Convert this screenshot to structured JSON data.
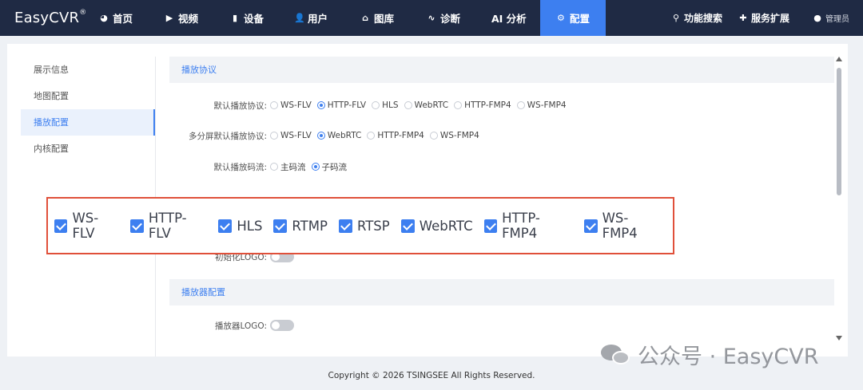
{
  "app": {
    "logo": "EasyCVR",
    "logo_mark": "®"
  },
  "nav": {
    "items": [
      {
        "label": "首页",
        "icon": "dashboard-icon",
        "glyph": "◕"
      },
      {
        "label": "视频",
        "icon": "play-icon",
        "glyph": "▶"
      },
      {
        "label": "设备",
        "icon": "device-icon",
        "glyph": "▮"
      },
      {
        "label": "用户",
        "icon": "user-icon",
        "glyph": "👤"
      },
      {
        "label": "图库",
        "icon": "gallery-icon",
        "glyph": "⌂"
      },
      {
        "label": "诊断",
        "icon": "pulse-icon",
        "glyph": "∿"
      },
      {
        "label": "AI 分析",
        "icon": "ai-icon",
        "glyph": ""
      },
      {
        "label": "配置",
        "icon": "gear-icon",
        "glyph": "⚙"
      }
    ],
    "active": "配置",
    "search_label": "功能搜索",
    "extension_label": "服务扩展",
    "user_label": "管理员",
    "accent_color": "#3d7ff0",
    "bg_color": "#1f2a44"
  },
  "sidebar": {
    "items": [
      "展示信息",
      "地图配置",
      "播放配置",
      "内核配置"
    ],
    "active": "播放配置"
  },
  "sections": {
    "play_protocol": "播放协议",
    "player_config": "播放器配置"
  },
  "rows": {
    "default_protocol": {
      "label": "默认播放协议:",
      "options": [
        "WS-FLV",
        "HTTP-FLV",
        "HLS",
        "WebRTC",
        "HTTP-FMP4",
        "WS-FMP4"
      ],
      "selected": "HTTP-FLV"
    },
    "multi_screen_protocol": {
      "label": "多分屏默认播放协议:",
      "options": [
        "WS-FLV",
        "WebRTC",
        "HTTP-FMP4",
        "WS-FMP4"
      ],
      "selected": "WebRTC"
    },
    "default_stream": {
      "label": "默认播放码流:",
      "options": [
        "主码流",
        "子码流"
      ],
      "selected": "子码流"
    },
    "init_logo": {
      "label": "初始化LOGO:",
      "enabled": false
    },
    "player_logo": {
      "label": "播放器LOGO:",
      "enabled": false
    }
  },
  "overlay": {
    "protocols": [
      "WS-FLV",
      "HTTP-FLV",
      "HLS",
      "RTMP",
      "RTSP",
      "WebRTC",
      "HTTP-FMP4",
      "WS-FMP4"
    ],
    "checked": [
      true,
      true,
      true,
      true,
      true,
      true,
      true,
      true
    ],
    "border_color": "#e0503a"
  },
  "footer": {
    "copyright": "Copyright © 2026 TSINGSEE All Rights Reserved."
  },
  "watermark": {
    "text": "公众号 · EasyCVR"
  }
}
